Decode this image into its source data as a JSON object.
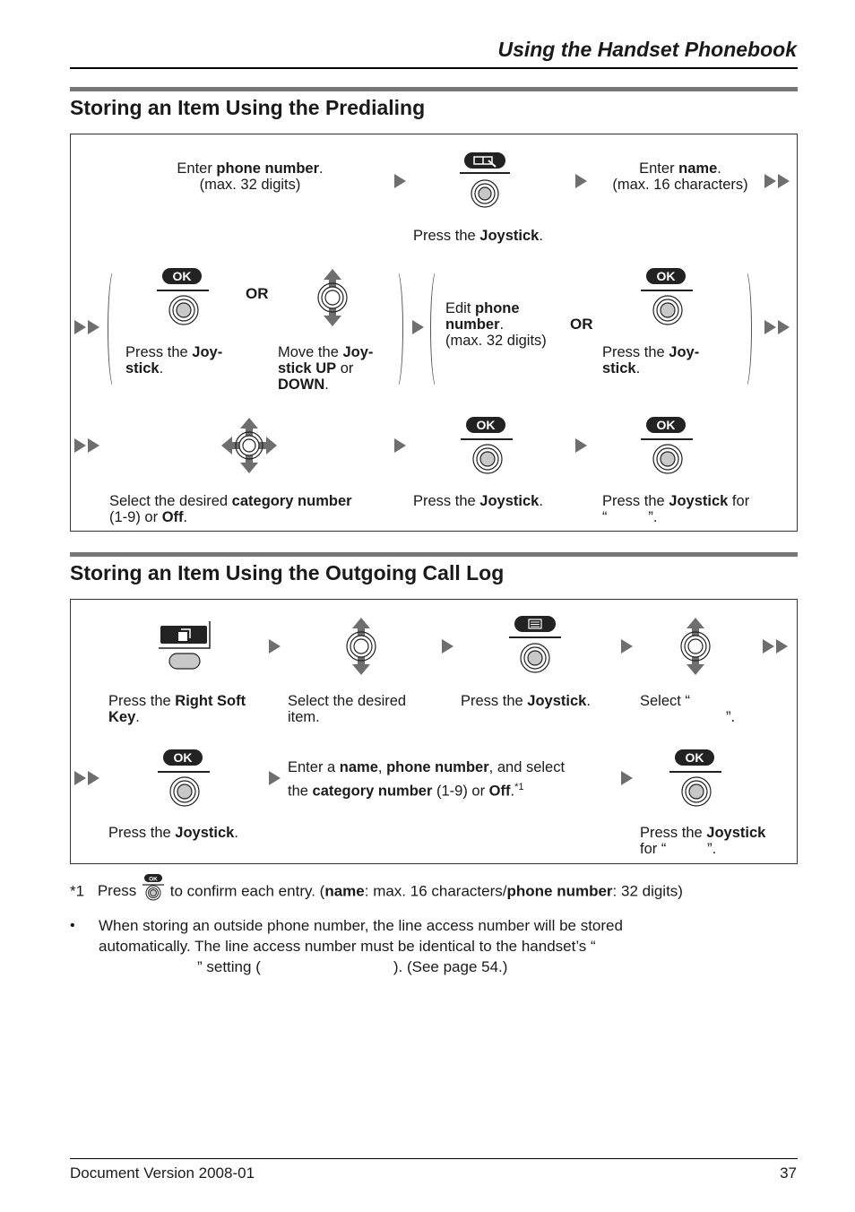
{
  "header": {
    "title": "Using the Handset Phonebook"
  },
  "section1": {
    "title": "Storing an Item Using the Predialing",
    "row1": {
      "step1": {
        "pre": "Enter ",
        "bold": "phone number",
        "post": ".",
        "line2": "(max. 32 digits)"
      },
      "step2": {
        "icon": "phonebook-edit-icon",
        "pre": "Press the ",
        "bold": "Joystick",
        "post": "."
      },
      "step3": {
        "pre": "Enter ",
        "bold": "name",
        "post": ".",
        "line2": "(max. 16 characters)"
      }
    },
    "row2": {
      "optA": {
        "pill": "OK",
        "pre": "Press the ",
        "bold1": "Joy-",
        "bold2": "stick",
        "post": "."
      },
      "or1": "OR",
      "optB": {
        "pre": "Move the ",
        "bold1": "Joy-",
        "bold2": "stick UP",
        "mid": " or",
        "bold3": "DOWN",
        "post": "."
      },
      "optC": {
        "pre": "Edit ",
        "bold1": "phone",
        "bold2": "number",
        "post": ".",
        "line3": "(max. 32 digits)"
      },
      "or2": "OR",
      "optD": {
        "pill": "OK",
        "pre": "Press the ",
        "bold1": "Joy-",
        "bold2": "stick",
        "post": "."
      }
    },
    "row3": {
      "step1": {
        "pre": "Select the desired ",
        "bold": "category number",
        "line2pre": "(1-9) or ",
        "line2bold": "Off",
        "post": "."
      },
      "step2": {
        "pill": "OK",
        "pre": "Press the ",
        "bold": "Joystick",
        "post": "."
      },
      "step3": {
        "pill": "OK",
        "pre": "Press the ",
        "bold": "Joystick",
        "post": " for",
        "line2": "“          ”."
      }
    }
  },
  "section2": {
    "title": "Storing an Item Using the Outgoing Call Log",
    "row1": {
      "step1": {
        "pre": "Press the ",
        "bold1": "Right Soft",
        "bold2": "Key",
        "post": "."
      },
      "step2": {
        "line1": "Select the desired",
        "line2": "item."
      },
      "step3": {
        "pre": "Press the ",
        "bold": "Joystick",
        "post": "."
      },
      "step4": {
        "line1": "Select “",
        "line2": "”."
      }
    },
    "row2": {
      "step1": {
        "pill": "OK",
        "pre": "Press the ",
        "bold": "Joystick",
        "post": "."
      },
      "step2": {
        "p1": "Enter a ",
        "b1": "name",
        "p2": ", ",
        "b2": "phone number",
        "p3": ", and select",
        "p4": "the ",
        "b3": "category number",
        "p5": " (1-9) or ",
        "b4": "Off",
        "p6": ".",
        "sup": "*1"
      },
      "step3": {
        "pill": "OK",
        "pre": "Press the ",
        "bold": "Joystick",
        "line2": "for “          ”."
      }
    }
  },
  "footnote": {
    "marker": "*1",
    "pre": "Press",
    "pill": "OK",
    "text1": " to confirm each entry. (",
    "b1": "name",
    "text2": ": max. 16 characters/",
    "b2": "phone number",
    "text3": ": 32 digits)"
  },
  "bullet": {
    "symbol": "•",
    "line1": "When storing an outside phone number, the line access number will be stored",
    "line2": "automatically. The line access number must be identical to the handset’s “",
    "line3a": "” setting (",
    "line3b": "). (See page 54.)"
  },
  "footer": {
    "left": "Document Version 2008-01",
    "page": "37"
  }
}
